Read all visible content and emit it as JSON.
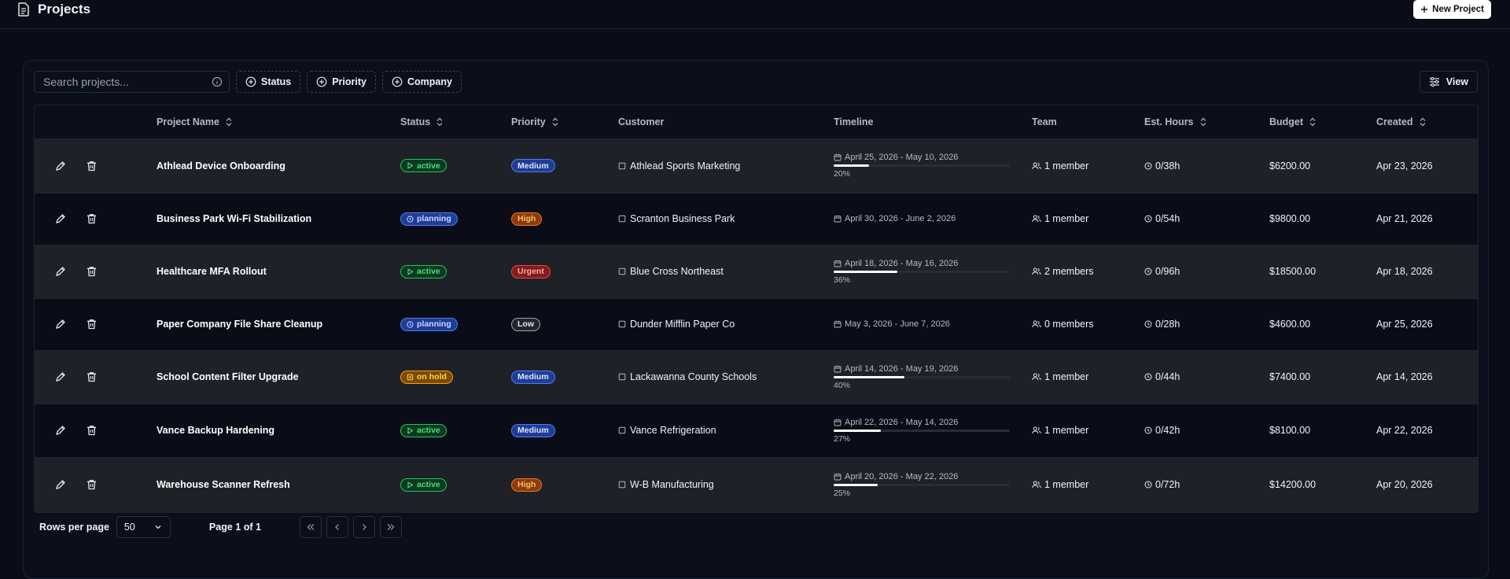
{
  "header": {
    "title": "Projects",
    "new_button_label": "New Project"
  },
  "toolbar": {
    "search_placeholder": "Search projects...",
    "filters": [
      "Status",
      "Priority",
      "Company"
    ],
    "view_label": "View"
  },
  "table": {
    "columns": [
      "Project Name",
      "Status",
      "Priority",
      "Customer",
      "Timeline",
      "Team",
      "Est. Hours",
      "Budget",
      "Created"
    ],
    "rows": [
      {
        "name": "Athlead Device Onboarding",
        "status": "active",
        "priority": "Medium",
        "customer": "Athlead Sports Marketing",
        "timeline": "April 25, 2026 - May 10, 2026",
        "progress": 20,
        "progress_label": "20%",
        "team": "1 member",
        "hours": "0/38h",
        "budget": "$6200.00",
        "created": "Apr 23, 2026"
      },
      {
        "name": "Business Park Wi-Fi Stabilization",
        "status": "planning",
        "priority": "High",
        "customer": "Scranton Business Park",
        "timeline": "April 30, 2026 - June 2, 2026",
        "progress": null,
        "progress_label": "",
        "team": "1 member",
        "hours": "0/54h",
        "budget": "$9800.00",
        "created": "Apr 21, 2026"
      },
      {
        "name": "Healthcare MFA Rollout",
        "status": "active",
        "priority": "Urgent",
        "customer": "Blue Cross Northeast",
        "timeline": "April 18, 2026 - May 16, 2026",
        "progress": 36,
        "progress_label": "36%",
        "team": "2 members",
        "hours": "0/96h",
        "budget": "$18500.00",
        "created": "Apr 18, 2026"
      },
      {
        "name": "Paper Company File Share Cleanup",
        "status": "planning",
        "priority": "Low",
        "customer": "Dunder Mifflin Paper Co",
        "timeline": "May 3, 2026 - June 7, 2026",
        "progress": null,
        "progress_label": "",
        "team": "0 members",
        "hours": "0/28h",
        "budget": "$4600.00",
        "created": "Apr 25, 2026"
      },
      {
        "name": "School Content Filter Upgrade",
        "status": "on hold",
        "priority": "Medium",
        "customer": "Lackawanna County Schools",
        "timeline": "April 14, 2026 - May 19, 2026",
        "progress": 40,
        "progress_label": "40%",
        "team": "1 member",
        "hours": "0/44h",
        "budget": "$7400.00",
        "created": "Apr 14, 2026"
      },
      {
        "name": "Vance Backup Hardening",
        "status": "active",
        "priority": "Medium",
        "customer": "Vance Refrigeration",
        "timeline": "April 22, 2026 - May 14, 2026",
        "progress": 27,
        "progress_label": "27%",
        "team": "1 member",
        "hours": "0/42h",
        "budget": "$8100.00",
        "created": "Apr 22, 2026"
      },
      {
        "name": "Warehouse Scanner Refresh",
        "status": "active",
        "priority": "High",
        "customer": "W-B Manufacturing",
        "timeline": "April 20, 2026 - May 22, 2026",
        "progress": 25,
        "progress_label": "25%",
        "team": "1 member",
        "hours": "0/72h",
        "budget": "$14200.00",
        "created": "Apr 20, 2026"
      }
    ]
  },
  "footer": {
    "rows_per_page_label": "Rows per page",
    "rows_per_page_value": "50",
    "page_info": "Page 1 of 1"
  },
  "colors": {
    "background": "#0a0d18",
    "row_alt": "#1e2128",
    "active": "#22c55e",
    "planning": "#4f7cf0",
    "on_hold": "#f59e0b",
    "urgent": "#ef4444",
    "high": "#f97316"
  },
  "icons": [
    "document-icon",
    "plus-icon",
    "info-icon",
    "plus-circle-icon",
    "sliders-icon",
    "sort-icon",
    "edit-icon",
    "trash-icon",
    "play-icon",
    "clock-icon",
    "pause-icon",
    "building-icon",
    "calendar-icon",
    "users-icon",
    "chevron-down-icon",
    "chevrons-left-icon",
    "chevron-left-icon",
    "chevron-right-icon",
    "chevrons-right-icon"
  ]
}
